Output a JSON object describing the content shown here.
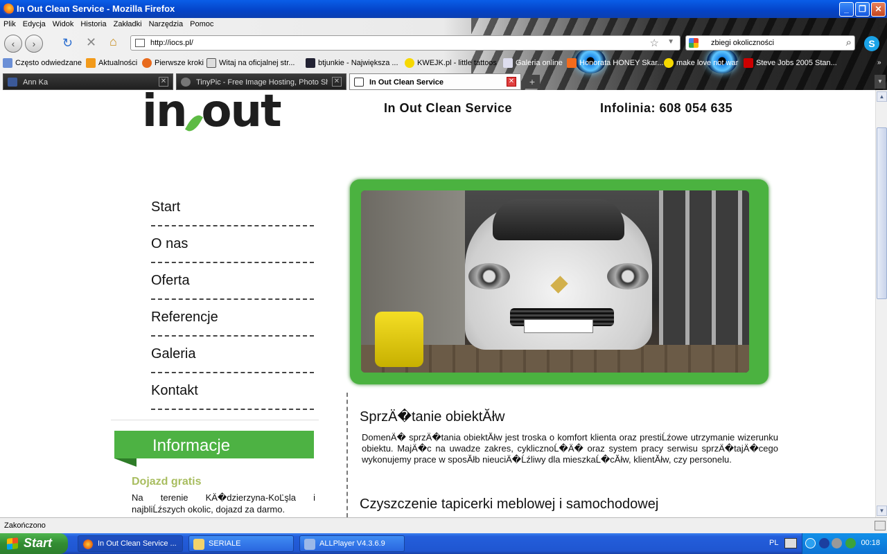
{
  "window": {
    "title": "In Out Clean Service - Mozilla Firefox"
  },
  "menu": [
    "Plik",
    "Edycja",
    "Widok",
    "Historia",
    "Zakładki",
    "Narzędzia",
    "Pomoc"
  ],
  "nav": {
    "url": "http://iocs.pl/",
    "search_query": "zbiegi okoliczności"
  },
  "bookmarks": [
    "Często odwiedzane",
    "Aktualności",
    "Pierwsze kroki",
    "Witaj na oficjalnej str...",
    "btjunkie - Największa ...",
    "KWEJK.pl - little tattoos",
    "Galeria online",
    "Honorata HONEY Skar...",
    "make love not war",
    "Steve Jobs 2005 Stan..."
  ],
  "tabs": [
    {
      "label": "Ann Ka",
      "active": false
    },
    {
      "label": "TinyPic - Free Image Hosting, Photo Sh...",
      "active": false
    },
    {
      "label": "In Out Clean Service",
      "active": true
    }
  ],
  "page": {
    "logo_text_left": "in",
    "logo_text_right": "out",
    "brand_name": "In Out Clean Service",
    "hotline": "Infolinia: 608 054 635",
    "side_nav": [
      "Start",
      "O nas",
      "Oferta",
      "Referencje",
      "Galeria",
      "Kontakt"
    ],
    "info": {
      "banner": "Informacje",
      "title": "Dojazd gratis",
      "text": "Na terenie KÄ�dzierzyna-KoĽşla i najbliĹźszych okolic, dojazd za darmo."
    },
    "section1": {
      "title": "SprzÄ�tanie obiektĂłw",
      "body": "DomenÄ� sprzÄ�tania obiektĂłw jest troska o komfort klienta oraz prestiĹźowe utrzymanie wizerunku obiektu. MajÄ�c na uwadze zakres, cyklicznoĹ�Ä� oraz system pracy serwisu sprzÄ�tajÄ�cego wykonujemy prace w sposĂłb nieuciÄ�Ĺźliwy dla mieszkaĹ�cĂłw, klientĂłw, czy personelu."
    },
    "section2": {
      "title": "Czyszczenie tapicerki meblowej i samochodowej"
    }
  },
  "statusbar": {
    "text": "Zakończono"
  },
  "taskbar": {
    "start": "Start",
    "tasks": [
      {
        "label": "In Out Clean Service ...",
        "active": true
      },
      {
        "label": "SERIALE",
        "active": false
      },
      {
        "label": "ALLPlayer V4.3.6.9",
        "active": false
      }
    ],
    "lang": "PL",
    "clock": "00:18"
  },
  "colors": {
    "accent_green": "#4db243",
    "info_title": "#a8bd5f",
    "xp_blue": "#245edb"
  }
}
